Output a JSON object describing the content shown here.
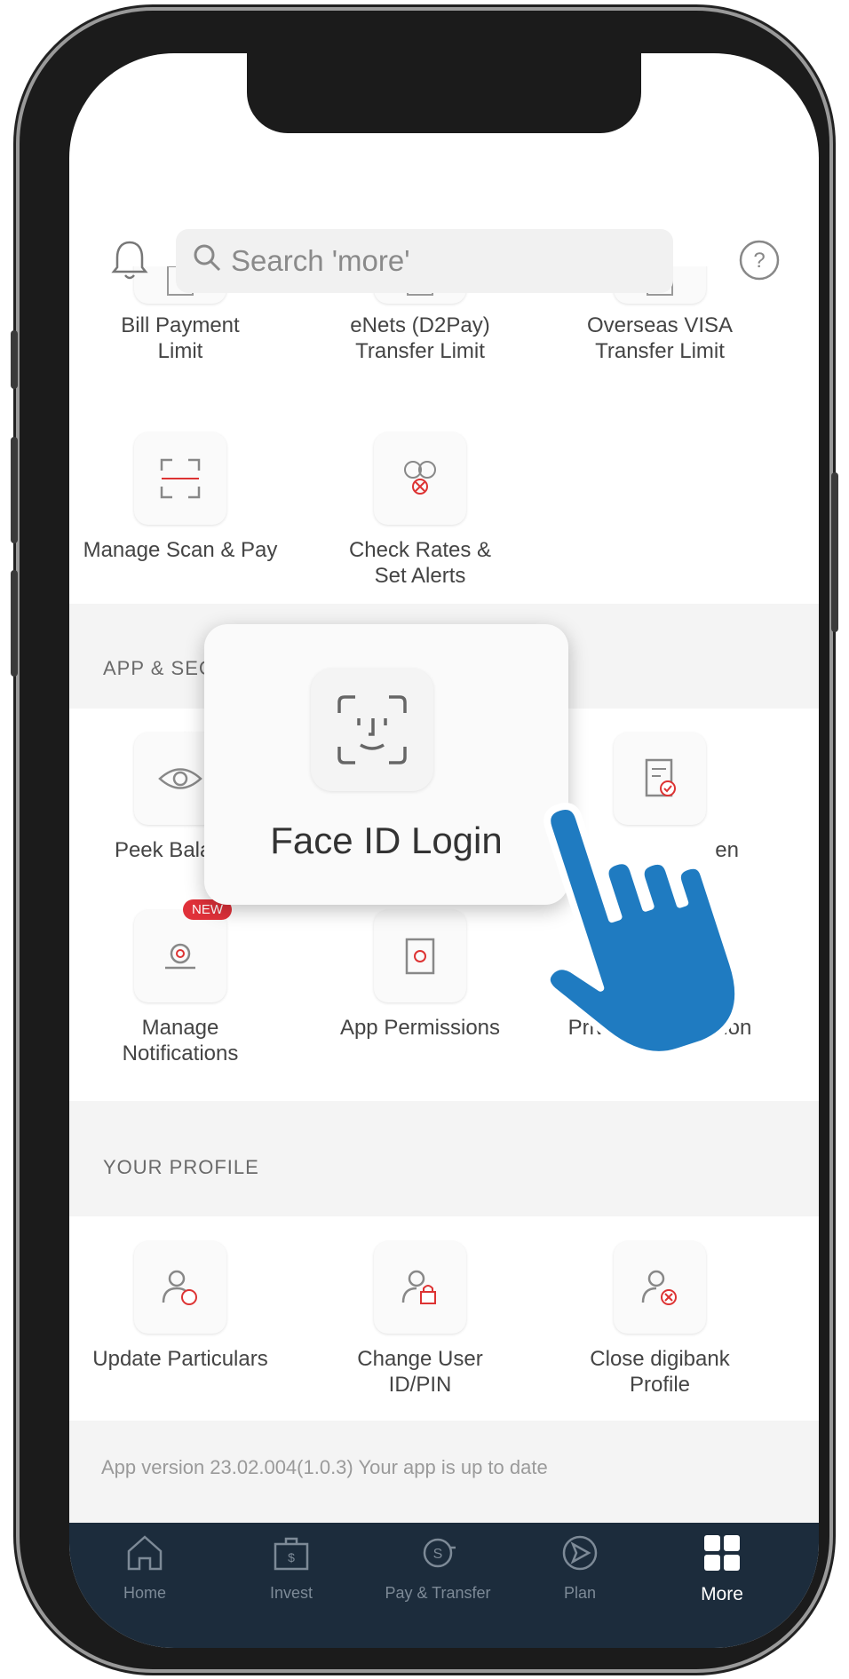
{
  "search": {
    "placeholder": "Search 'more'"
  },
  "limits": {
    "items": [
      {
        "label": "Bill Payment Limit",
        "icon": "bill-limit-icon"
      },
      {
        "label": "eNets (D2Pay) Transfer Limit",
        "icon": "enets-limit-icon"
      },
      {
        "label": "Overseas VISA Transfer Limit",
        "icon": "visa-limit-icon"
      },
      {
        "label": "Manage Scan & Pay",
        "icon": "scan-icon"
      },
      {
        "label": "Check Rates & Set Alerts",
        "icon": "currency-icon"
      }
    ]
  },
  "app_security": {
    "title": "APP & SECURITY SETTINGS",
    "items": [
      {
        "label": "Peek Balance",
        "icon": "eye-icon"
      },
      {
        "label": "Manage Notifications",
        "icon": "gear-bell-icon",
        "badge": "NEW"
      },
      {
        "label": "App Permissions",
        "icon": "permissions-icon"
      },
      {
        "label": "Privacy Declaration",
        "icon": "document-check-icon"
      }
    ],
    "partial_label": "en"
  },
  "popup": {
    "label": "Face ID Login",
    "icon": "face-id-icon"
  },
  "profile": {
    "title": "YOUR PROFILE",
    "items": [
      {
        "label": "Update Particulars",
        "icon": "user-edit-icon"
      },
      {
        "label": "Change User ID/PIN",
        "icon": "user-lock-icon"
      },
      {
        "label": "Close digibank Profile",
        "icon": "user-close-icon"
      }
    ]
  },
  "version_text": "App version 23.02.004(1.0.3) Your app is up to date",
  "tabs": [
    {
      "label": "Home",
      "icon": "home-icon"
    },
    {
      "label": "Invest",
      "icon": "invest-icon"
    },
    {
      "label": "Pay & Transfer",
      "icon": "pay-transfer-icon"
    },
    {
      "label": "Plan",
      "icon": "plan-icon"
    },
    {
      "label": "More",
      "icon": "more-grid-icon",
      "active": true
    }
  ],
  "colors": {
    "accent_red": "#e0313a",
    "tabbar": "#1c2c3c",
    "hand": "#1f7bc1"
  }
}
